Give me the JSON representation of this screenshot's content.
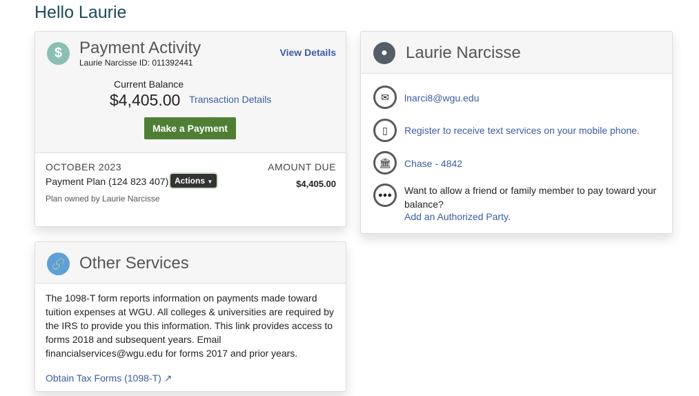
{
  "greeting": "Hello Laurie",
  "payment": {
    "title": "Payment Activity",
    "subtitle": "Laurie Narcisse ID: 011392441",
    "view_details": "View Details",
    "balance_label": "Current Balance",
    "balance": "$4,405.00",
    "transaction_details": "Transaction Details",
    "make_payment": "Make a Payment",
    "month": "OCTOBER 2023",
    "plan": "Payment Plan (124 823 407)",
    "actions": "Actions",
    "amount_due_label": "AMOUNT DUE",
    "amount_due": "$4,405.00",
    "owner": "Plan owned by Laurie Narcisse"
  },
  "profile": {
    "name": "Laurie Narcisse",
    "email": "lnarci8@wgu.edu",
    "sms": "Register to receive text services on your mobile phone.",
    "bank": "Chase - 4842",
    "auth_text": "Want to allow a friend or family member to pay toward your balance?",
    "auth_link": "Add an Authorized Party."
  },
  "services": {
    "title": "Other Services",
    "body": "The 1098-T form reports information on payments made toward tuition expenses at WGU. All colleges & universities are required by the IRS to provide you this information. This link provides access to forms 2018 and subsequent years. Email financialservices@wgu.edu for forms 2017 and prior years.",
    "tax_link": "Obtain Tax Forms (1098-T)"
  }
}
